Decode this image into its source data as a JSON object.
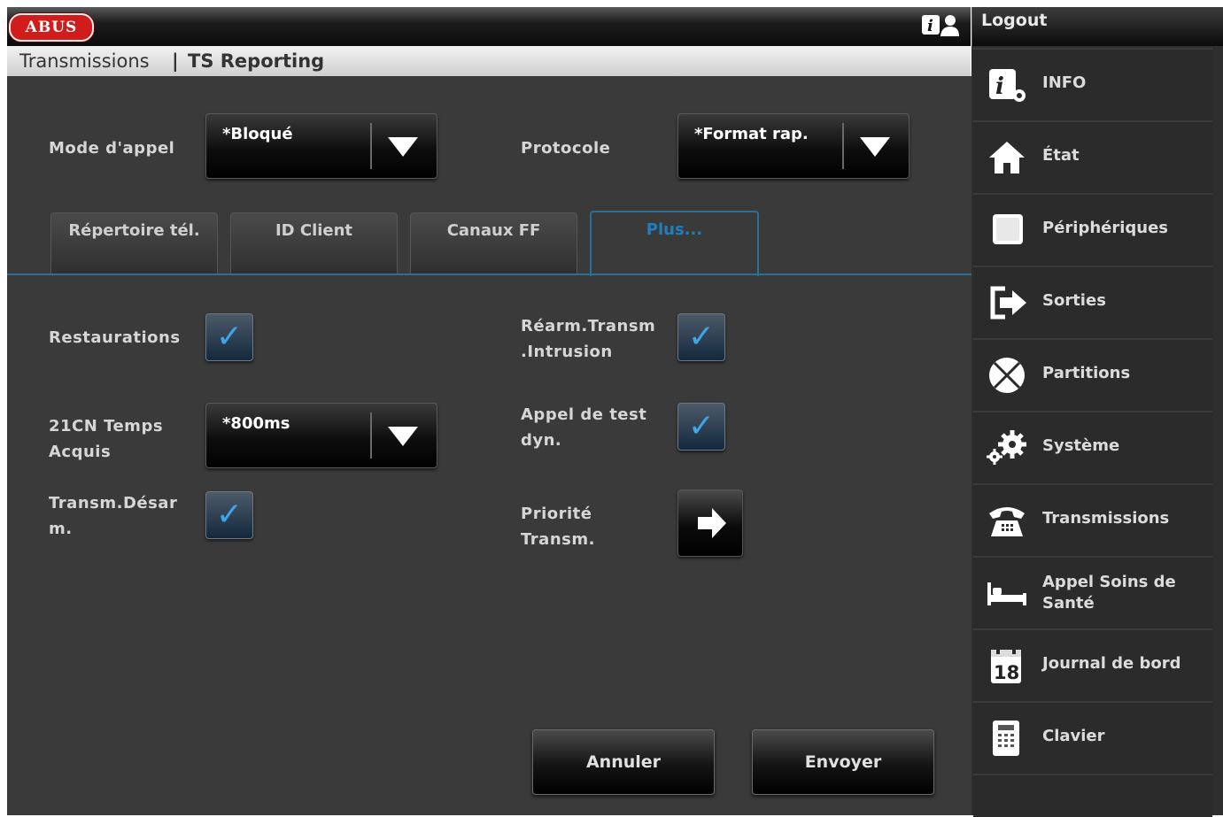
{
  "header": {
    "logo_text": "ABUS",
    "breadcrumb_parent": "Transmissions",
    "breadcrumb_separator": "|",
    "breadcrumb_current": "TS Reporting",
    "logout_label": "Logout"
  },
  "form": {
    "call_mode": {
      "label": "Mode d'appel",
      "value": "*Bloqué"
    },
    "protocol": {
      "label": "Protocole",
      "value": "*Format rap."
    },
    "tabs": [
      {
        "label": "Répertoire tél.",
        "active": false
      },
      {
        "label": "ID Client",
        "active": false
      },
      {
        "label": "Canaux FF",
        "active": false
      },
      {
        "label": "Plus...",
        "active": true
      }
    ],
    "restaurations": {
      "label": "Restaurations",
      "checked": true
    },
    "rearm": {
      "label_line1": "Réarm.Transm",
      "label_line2": ".Intrusion",
      "checked": true
    },
    "temps_acquis": {
      "label_line1": "21CN Temps",
      "label_line2": "Acquis",
      "value": "*800ms"
    },
    "test_call": {
      "label_line1": "Appel de test",
      "label_line2": "dyn.",
      "checked": true
    },
    "disarm": {
      "label_line1": "Transm.Désar",
      "label_line2": "m.",
      "checked": true
    },
    "priority": {
      "label_line1": "Priorité",
      "label_line2": "Transm."
    },
    "cancel_label": "Annuler",
    "send_label": "Envoyer"
  },
  "sidebar": {
    "items": [
      {
        "label": "INFO",
        "icon": "info-gear-icon"
      },
      {
        "label": "État",
        "icon": "home-icon"
      },
      {
        "label": "Périphériques",
        "icon": "square-device-icon"
      },
      {
        "label": "Sorties",
        "icon": "exit-arrow-icon"
      },
      {
        "label": "Partitions",
        "icon": "pie-partition-icon"
      },
      {
        "label": "Système",
        "icon": "gears-icon"
      },
      {
        "label": "Transmissions",
        "icon": "telephone-icon"
      },
      {
        "label_line1": "Appel Soins de",
        "label_line2": "Santé",
        "icon": "bed-icon"
      },
      {
        "label": "Journal de bord",
        "icon": "calendar-icon",
        "calendar_day": "18"
      },
      {
        "label": "Clavier",
        "icon": "keypad-icon"
      }
    ]
  },
  "colors": {
    "accent_blue": "#1e7fc0",
    "panel_bg": "#3a3a3a",
    "logo_red": "#d11c1c"
  }
}
